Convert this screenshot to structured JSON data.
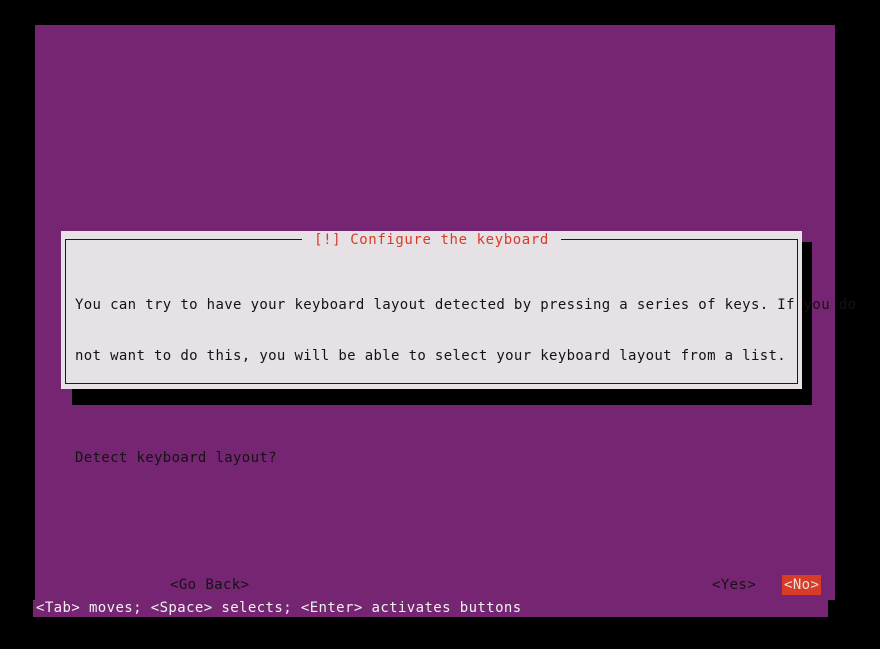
{
  "screen": {
    "background_color": "#000000",
    "canvas_color": "#762572",
    "accent_color": "#d83b26",
    "panel_color": "#e6e1e5",
    "text_color": "#131313"
  },
  "dialog": {
    "title": "[!] Configure the keyboard",
    "body_lines": [
      "You can try to have your keyboard layout detected by pressing a series of keys. If you do",
      "not want to do this, you will be able to select your keyboard layout from a list.",
      "",
      "Detect keyboard layout?"
    ],
    "buttons": [
      {
        "label": "<Go Back>",
        "selected": false
      },
      {
        "label": "<Yes>",
        "selected": false
      },
      {
        "label": "<No>",
        "selected": true
      }
    ]
  },
  "status_bar": {
    "text": "<Tab> moves; <Space> selects; <Enter> activates buttons"
  }
}
